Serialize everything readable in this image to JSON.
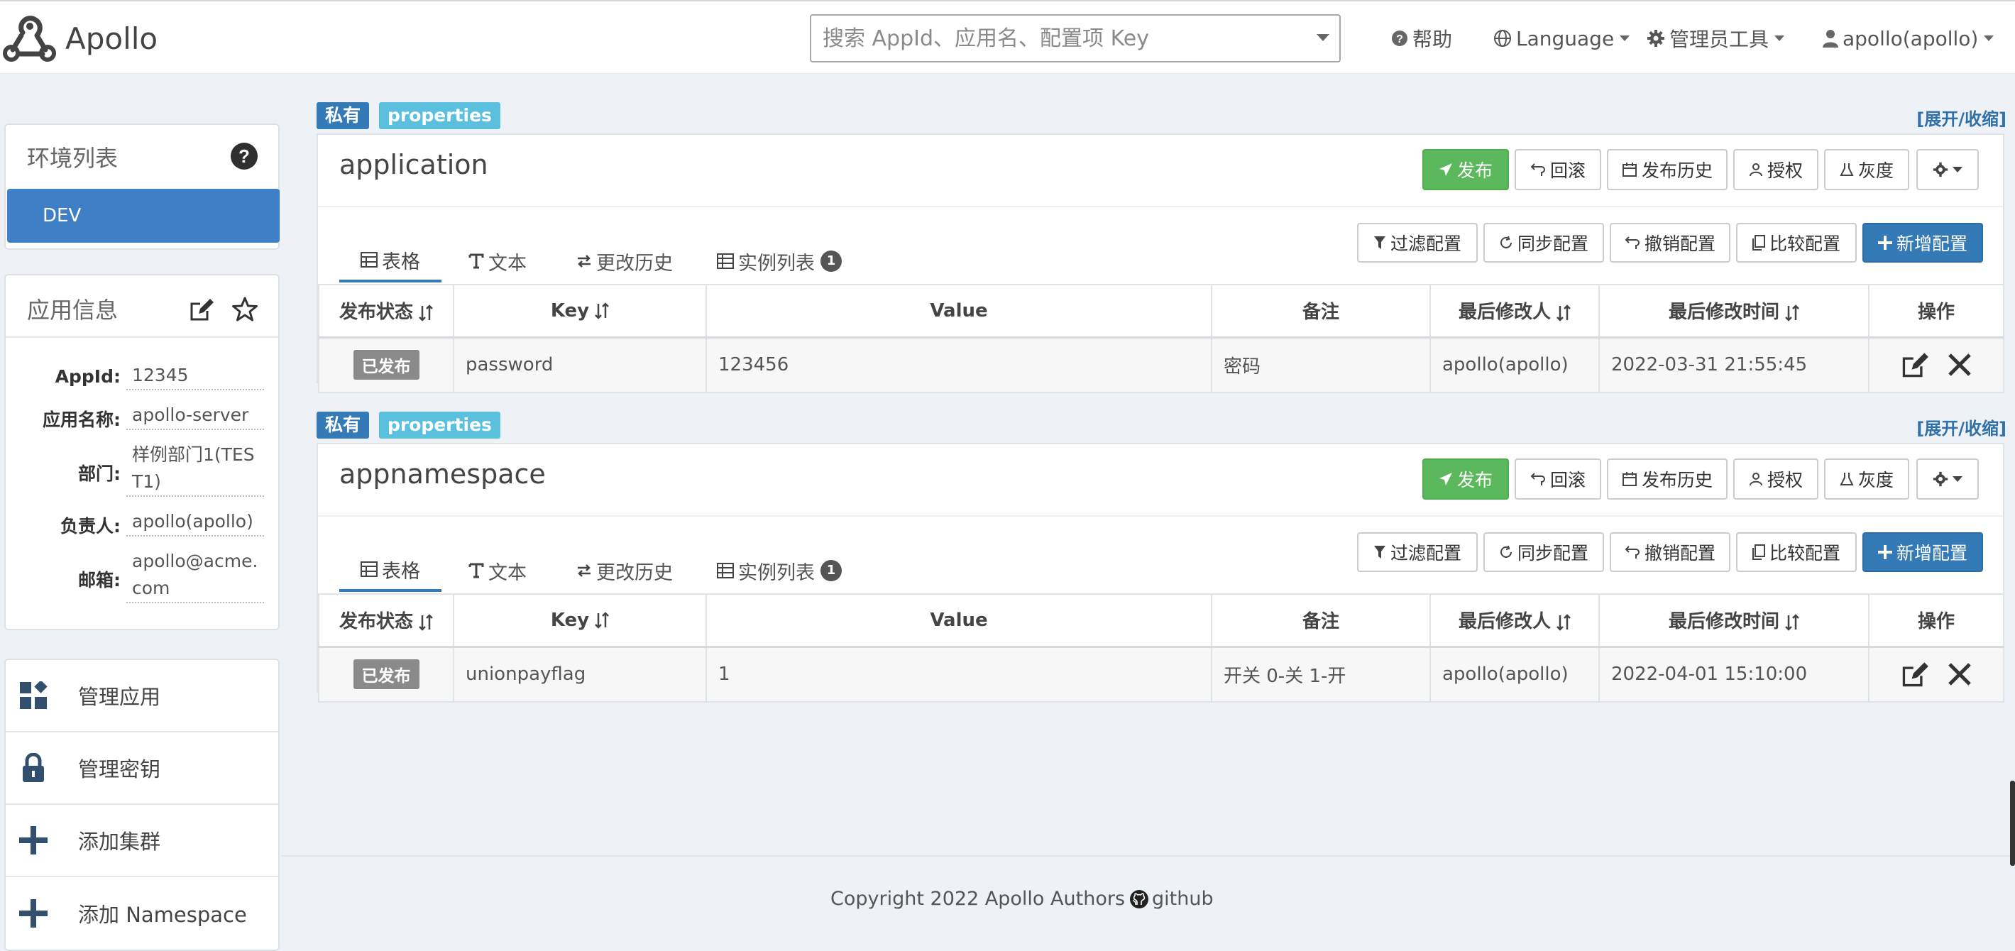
{
  "app": {
    "brand": "Apollo"
  },
  "navbar": {
    "search_placeholder": "搜索 AppId、应用名、配置项 Key",
    "help": "帮助",
    "language": "Language",
    "admin_tools": "管理员工具",
    "user": "apollo(apollo)"
  },
  "env_panel": {
    "title": "环境列表",
    "items": [
      "DEV"
    ]
  },
  "app_info": {
    "title": "应用信息",
    "rows": [
      {
        "label": "AppId:",
        "value": "12345"
      },
      {
        "label": "应用名称:",
        "value": "apollo-server"
      },
      {
        "label": "部门:",
        "value": "样例部门1(TEST1)"
      },
      {
        "label": "负责人:",
        "value": "apollo(apollo)"
      },
      {
        "label": "邮箱:",
        "value": "apollo@acme.com"
      }
    ]
  },
  "side_menu": [
    {
      "label": "管理应用",
      "icon": "dashboard-icon"
    },
    {
      "label": "管理密钥",
      "icon": "lock-icon"
    },
    {
      "label": "添加集群",
      "icon": "plus-icon"
    },
    {
      "label": "添加 Namespace",
      "icon": "plus-icon"
    }
  ],
  "namespaces": [
    {
      "badge_private": "私有",
      "badge_format": "properties",
      "expand_toggle": "[展开/收缩]",
      "name": "application",
      "actions": {
        "publish": "发布",
        "rollback": "回滚",
        "history": "发布历史",
        "grant": "授权",
        "gray": "灰度"
      },
      "tabs": {
        "table": "表格",
        "text": "文本",
        "change_history": "更改历史",
        "instances": "实例列表",
        "instance_count": "1"
      },
      "toolbar": {
        "filter": "过滤配置",
        "sync": "同步配置",
        "revoke": "撤销配置",
        "compare": "比较配置",
        "add": "新增配置"
      },
      "columns": [
        "发布状态",
        "Key",
        "Value",
        "备注",
        "最后修改人",
        "最后修改时间",
        "操作"
      ],
      "rows": [
        {
          "status": "已发布",
          "key": "password",
          "value": "123456",
          "comment": "密码",
          "modifier": "apollo(apollo)",
          "modified_time": "2022-03-31 21:55:45"
        }
      ]
    },
    {
      "badge_private": "私有",
      "badge_format": "properties",
      "expand_toggle": "[展开/收缩]",
      "name": "appnamespace",
      "actions": {
        "publish": "发布",
        "rollback": "回滚",
        "history": "发布历史",
        "grant": "授权",
        "gray": "灰度"
      },
      "tabs": {
        "table": "表格",
        "text": "文本",
        "change_history": "更改历史",
        "instances": "实例列表",
        "instance_count": "1"
      },
      "toolbar": {
        "filter": "过滤配置",
        "sync": "同步配置",
        "revoke": "撤销配置",
        "compare": "比较配置",
        "add": "新增配置"
      },
      "columns": [
        "发布状态",
        "Key",
        "Value",
        "备注",
        "最后修改人",
        "最后修改时间",
        "操作"
      ],
      "rows": [
        {
          "status": "已发布",
          "key": "unionpayflag",
          "value": "1",
          "comment": "开关 0-关 1-开",
          "modifier": "apollo(apollo)",
          "modified_time": "2022-04-01 15:10:00"
        }
      ]
    }
  ],
  "footer": {
    "copyright": "Copyright 2022 Apollo Authors",
    "link": "github"
  },
  "colors": {
    "primary": "#337ab7",
    "success": "#5cb85c",
    "info": "#5bc0de",
    "env_active": "#3f7fc6",
    "page_bg": "#eef1f6"
  }
}
